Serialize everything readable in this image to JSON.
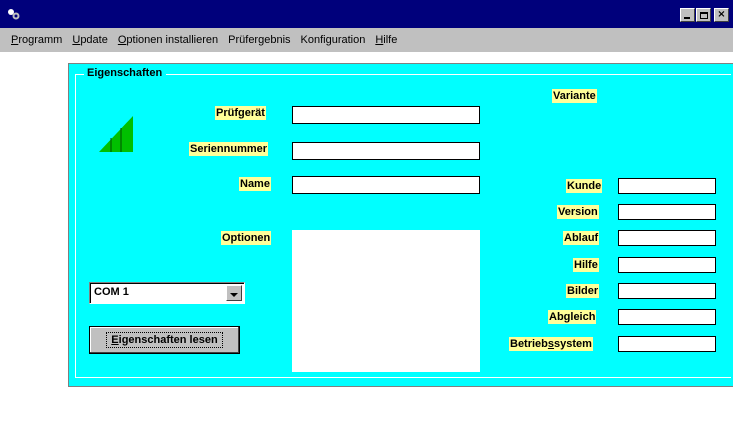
{
  "titlebar": {
    "title": "",
    "buttons": [
      "minimize-icon",
      "maximize-icon",
      "close-icon"
    ],
    "close_glyph": "×"
  },
  "menu": [
    {
      "mnemonic": "P",
      "rest": "rogramm"
    },
    {
      "mnemonic": "U",
      "rest": "pdate"
    },
    {
      "mnemonic": "O",
      "rest": "ptionen installieren"
    },
    {
      "mnemonic": "",
      "rest": "Prüfergebnis"
    },
    {
      "mnemonic": "",
      "rest": "Konfiguration"
    },
    {
      "mnemonic": "H",
      "rest": "ilfe"
    }
  ],
  "group": {
    "title": "Eigenschaften"
  },
  "left_labels": {
    "pruefgeraet": "Prüfgerät",
    "seriennummer": "Seriennummer",
    "name": "Name",
    "optionen": "Optionen"
  },
  "right_labels": {
    "variante": "Variante",
    "kunde": "Kunde",
    "version": "Version",
    "ablauf": "Ablauf",
    "hilfe": "Hilfe",
    "bilder": "Bilder",
    "abgleich": "Abgleich",
    "betriebssystem_pre": "Betrieb",
    "betriebssystem_mn": "s",
    "betriebssystem_post": "system"
  },
  "fields": {
    "pruefgeraet": "",
    "seriennummer": "",
    "name": "",
    "optionen": "",
    "kunde": "",
    "version": "",
    "ablauf": "",
    "hilfe": "",
    "bilder": "",
    "abgleich": "",
    "betriebssystem": ""
  },
  "port_select": {
    "value": "COM 1"
  },
  "read_button": {
    "mnemonic": "E",
    "rest": "igenschaften lesen"
  },
  "colors": {
    "titlebar": "#00007b",
    "panel": "#00ffff",
    "label_bg": "#ffff99",
    "signal_icon": "#00c000"
  },
  "icons": {
    "app": "app-icon",
    "signal": "signal-strength-icon"
  }
}
